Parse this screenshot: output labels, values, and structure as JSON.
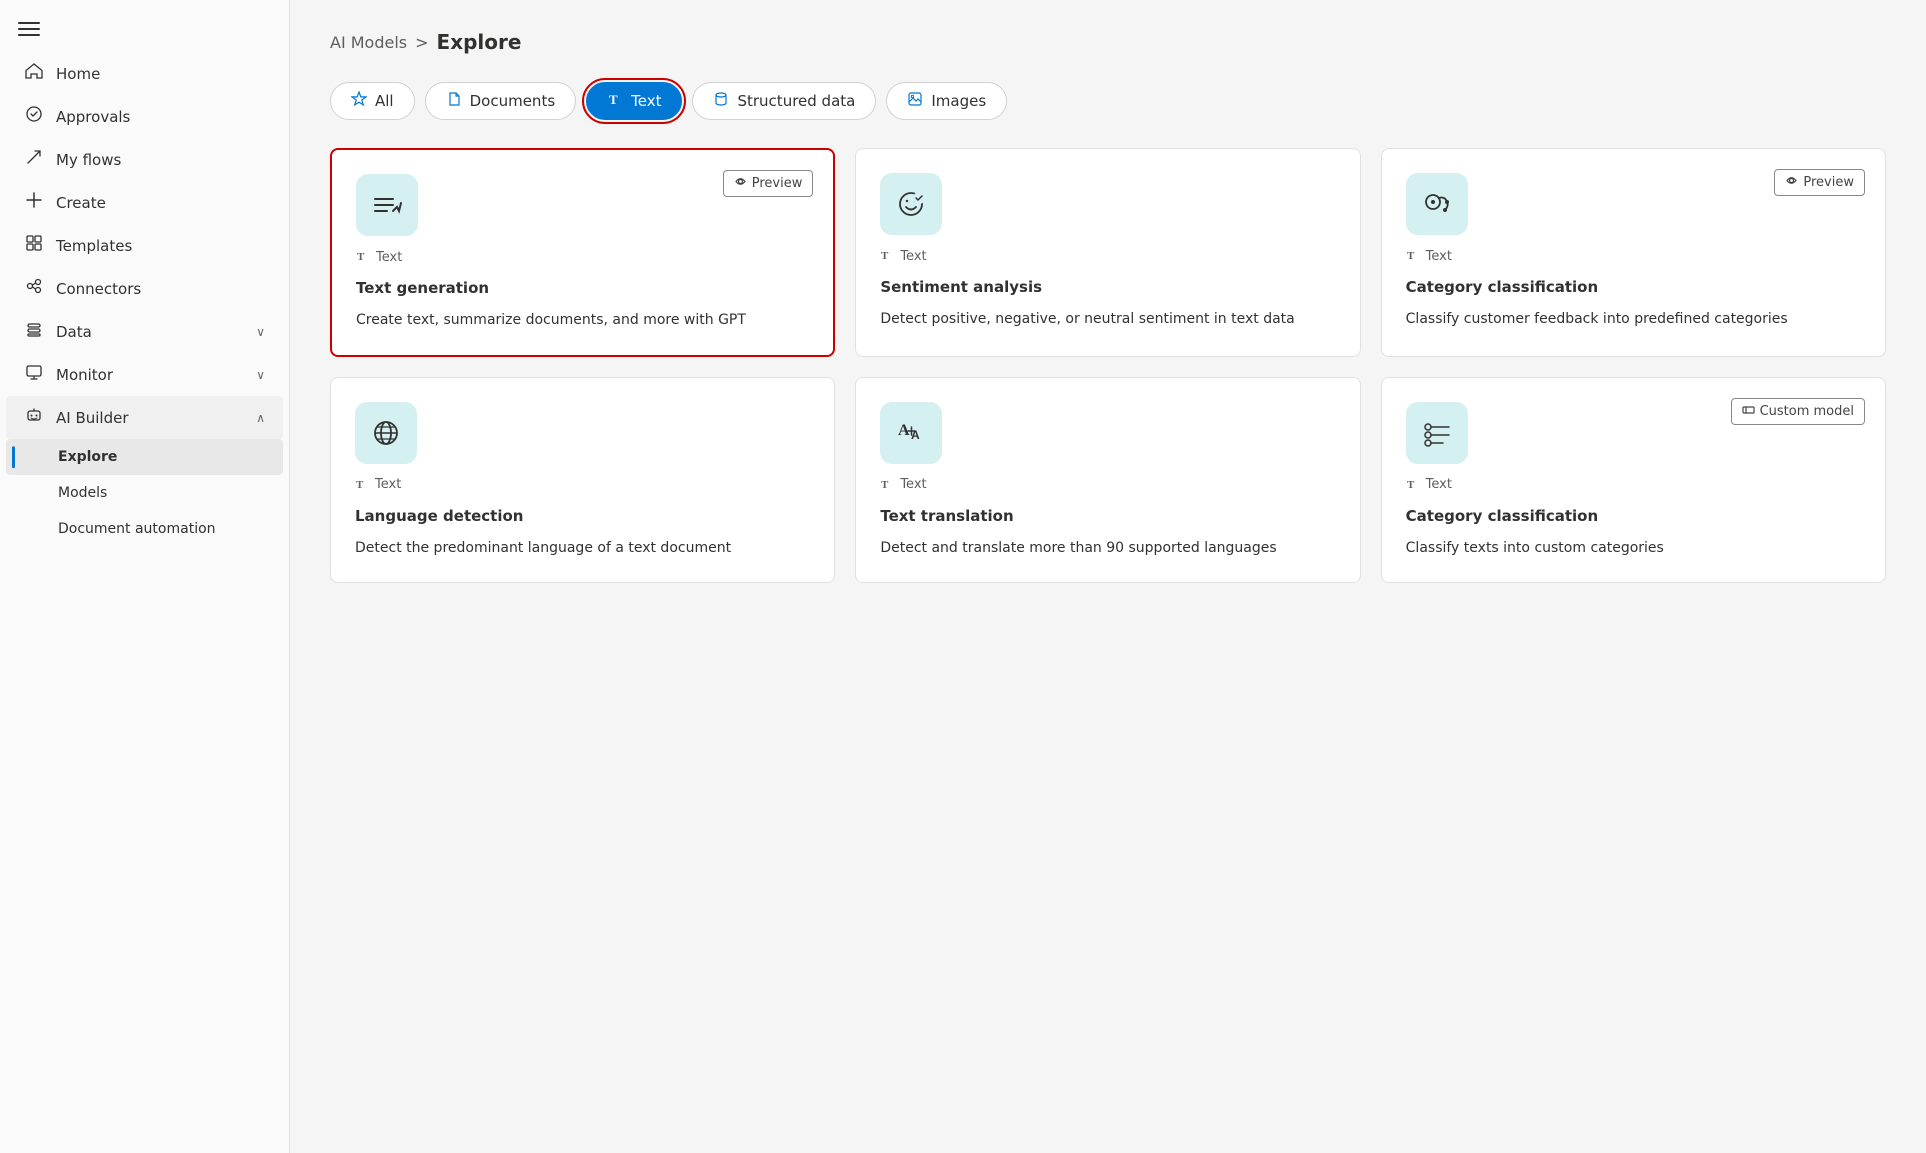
{
  "sidebar": {
    "nav_items": [
      {
        "id": "home",
        "label": "Home",
        "icon": "🏠",
        "has_chevron": false
      },
      {
        "id": "approvals",
        "label": "Approvals",
        "icon": "◑",
        "has_chevron": false
      },
      {
        "id": "my-flows",
        "label": "My flows",
        "icon": "↗",
        "has_chevron": false
      },
      {
        "id": "create",
        "label": "Create",
        "icon": "+",
        "has_chevron": false
      },
      {
        "id": "templates",
        "label": "Templates",
        "icon": "⊞",
        "has_chevron": false
      },
      {
        "id": "connectors",
        "label": "Connectors",
        "icon": "⌖",
        "has_chevron": false
      },
      {
        "id": "data",
        "label": "Data",
        "icon": "🗄",
        "has_chevron": true
      },
      {
        "id": "monitor",
        "label": "Monitor",
        "icon": "📊",
        "has_chevron": true
      },
      {
        "id": "ai-builder",
        "label": "AI Builder",
        "icon": "🤖",
        "has_chevron": true,
        "expanded": true
      }
    ],
    "sub_items": [
      {
        "id": "explore",
        "label": "Explore",
        "active": true
      },
      {
        "id": "models",
        "label": "Models",
        "active": false
      },
      {
        "id": "document-automation",
        "label": "Document automation",
        "active": false
      }
    ]
  },
  "breadcrumb": {
    "parent": "AI Models",
    "separator": ">",
    "current": "Explore"
  },
  "tabs": [
    {
      "id": "all",
      "label": "All",
      "icon": "★",
      "active": false
    },
    {
      "id": "documents",
      "label": "Documents",
      "icon": "📄",
      "active": false
    },
    {
      "id": "text",
      "label": "Text",
      "icon": "T",
      "active": true
    },
    {
      "id": "structured-data",
      "label": "Structured data",
      "icon": "🗄",
      "active": false
    },
    {
      "id": "images",
      "label": "Images",
      "icon": "🖼",
      "active": false
    }
  ],
  "cards": [
    {
      "id": "text-generation",
      "highlighted": true,
      "icon": "≡→",
      "badge": "Preview",
      "type": "Text",
      "title": "Text generation",
      "description": "Create text, summarize documents, and more with GPT"
    },
    {
      "id": "sentiment-analysis",
      "highlighted": false,
      "icon": "😊",
      "badge": null,
      "type": "Text",
      "title": "Sentiment analysis",
      "description": "Detect positive, negative, or neutral sentiment in text data"
    },
    {
      "id": "category-classification-1",
      "highlighted": false,
      "icon": "💬",
      "badge": "Preview",
      "type": "Text",
      "title": "Category classification",
      "description": "Classify customer feedback into predefined categories"
    },
    {
      "id": "language-detection",
      "highlighted": false,
      "icon": "🌐",
      "badge": null,
      "type": "Text",
      "title": "Language detection",
      "description": "Detect the predominant language of a text document"
    },
    {
      "id": "text-translation",
      "highlighted": false,
      "icon": "A↔",
      "badge": null,
      "type": "Text",
      "title": "Text translation",
      "description": "Detect and translate more than 90 supported languages"
    },
    {
      "id": "category-classification-2",
      "highlighted": false,
      "icon": "☰",
      "badge": "Custom model",
      "type": "Text",
      "title": "Category classification",
      "description": "Classify texts into custom categories"
    }
  ],
  "labels": {
    "preview": "Preview",
    "custom_model": "Custom model",
    "type_text": "Text"
  }
}
